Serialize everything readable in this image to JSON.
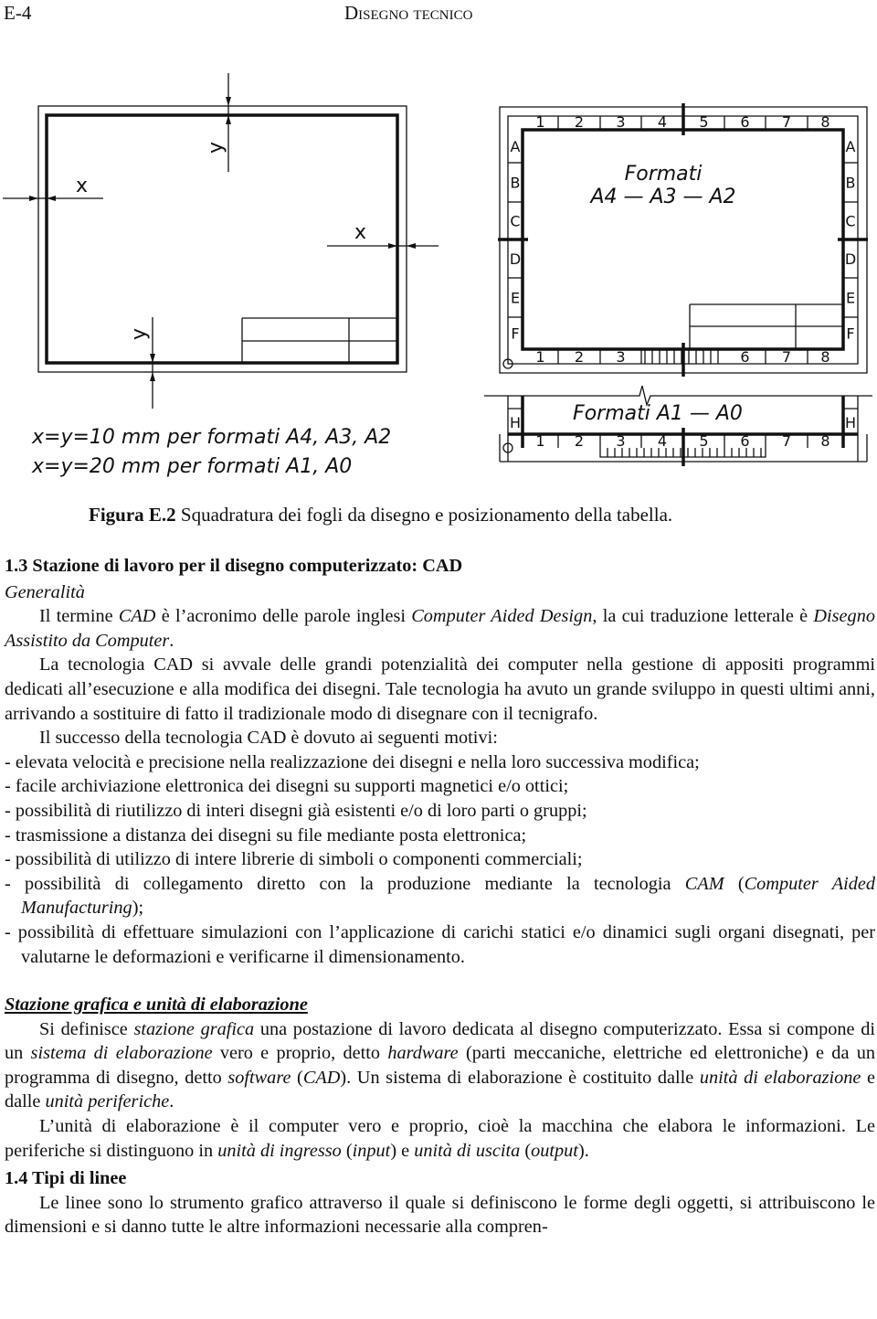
{
  "header": {
    "page_number": "E-4",
    "running_title": "Disegno tecnico"
  },
  "figure": {
    "left": {
      "dim_x": "x",
      "dim_y": "y",
      "note_1": "x=y=10 mm per formati A4, A3, A2",
      "note_2": "x=y=20 mm per formati A1, A0"
    },
    "right": {
      "columns": [
        "1",
        "2",
        "3",
        "4",
        "5",
        "6",
        "7",
        "8"
      ],
      "rows": [
        "A",
        "B",
        "C",
        "D",
        "E",
        "F"
      ],
      "bottom_columns": [
        "1",
        "2",
        "3",
        "",
        "",
        "6",
        "7",
        "8"
      ],
      "title_1": "Formati",
      "title_2": "A4  —  A3  —  A2",
      "row_h": "H",
      "title_3": "Formati  A1  —  A0"
    },
    "caption_label": "Figura E.2",
    "caption_text": " Squadratura dei fogli da disegno e posizionamento della tabella."
  },
  "section_13": {
    "title": "1.3  Stazione di lavoro per il disegno computerizzato: CAD",
    "subtitle": "Generalità",
    "p1": [
      "Il termine ",
      "CAD",
      " è l’acronimo delle parole inglesi ",
      "Computer Aided Design",
      ", la cui traduzione letterale è ",
      "Disegno Assistito da Computer",
      "."
    ],
    "p2": "La tecnologia CAD si avvale delle grandi potenzialità dei computer nella gestione di appositi programmi dedicati all’esecuzione e alla modifica dei disegni. Tale tecnologia ha avuto un grande sviluppo in questi ultimi anni, arrivando a sostituire di fatto il tradizionale modo di disegnare con il tecnigrafo.",
    "p3": "Il successo della tecnologia CAD è dovuto ai seguenti motivi:",
    "list": [
      "- elevata velocità e precisione nella realizzazione dei disegni e nella loro successiva modifica;",
      "- facile archiviazione elettronica dei disegni su supporti magnetici e/o ottici;",
      "- possibilità di riutilizzo di interi disegni già esistenti e/o di loro parti o gruppi;",
      "- trasmissione a distanza dei disegni su file mediante posta elettronica;",
      "- possibilità di utilizzo di intere librerie di simboli o componenti commerciali;"
    ],
    "list_cam": [
      "- possibilità di collegamento diretto con la produzione mediante la tecnologia ",
      "CAM",
      " (",
      "Computer Aided Manufacturing",
      ");"
    ],
    "list_last": "- possibilità di effettuare simulazioni con l’applicazione di carichi statici e/o dinamici sugli organi disegnati, per valutarne le deformazioni e verificarne il dimensionamento."
  },
  "stazione": {
    "title": "Stazione grafica e unità di elaborazione",
    "p1": [
      "Si definisce ",
      "stazione grafica",
      " una postazione di lavoro dedicata al disegno computerizzato. Essa si compone di un ",
      "sistema di elaborazione",
      " vero e proprio, detto ",
      "hardware",
      " (parti meccaniche, elettriche ed elettroniche) e da un programma di disegno, detto ",
      "software",
      " (",
      "CAD",
      "). Un sistema di elaborazione è costituito dalle ",
      "unità di elaborazione",
      " e dalle ",
      "unità periferiche",
      "."
    ],
    "p2": [
      "L’unità di elaborazione è il computer vero e proprio, cioè la macchina che elabora le informazioni. Le periferiche si distinguono in ",
      "unità di ingresso",
      " (",
      "input",
      ") e ",
      "unità di uscita",
      " (",
      "output",
      ")."
    ]
  },
  "section_14": {
    "title": "1.4  Tipi di linee",
    "p1": "Le linee sono lo strumento grafico attraverso il quale si definiscono le forme degli oggetti, si attribuiscono le dimensioni e si danno tutte le altre informazioni necessarie alla compren-"
  }
}
